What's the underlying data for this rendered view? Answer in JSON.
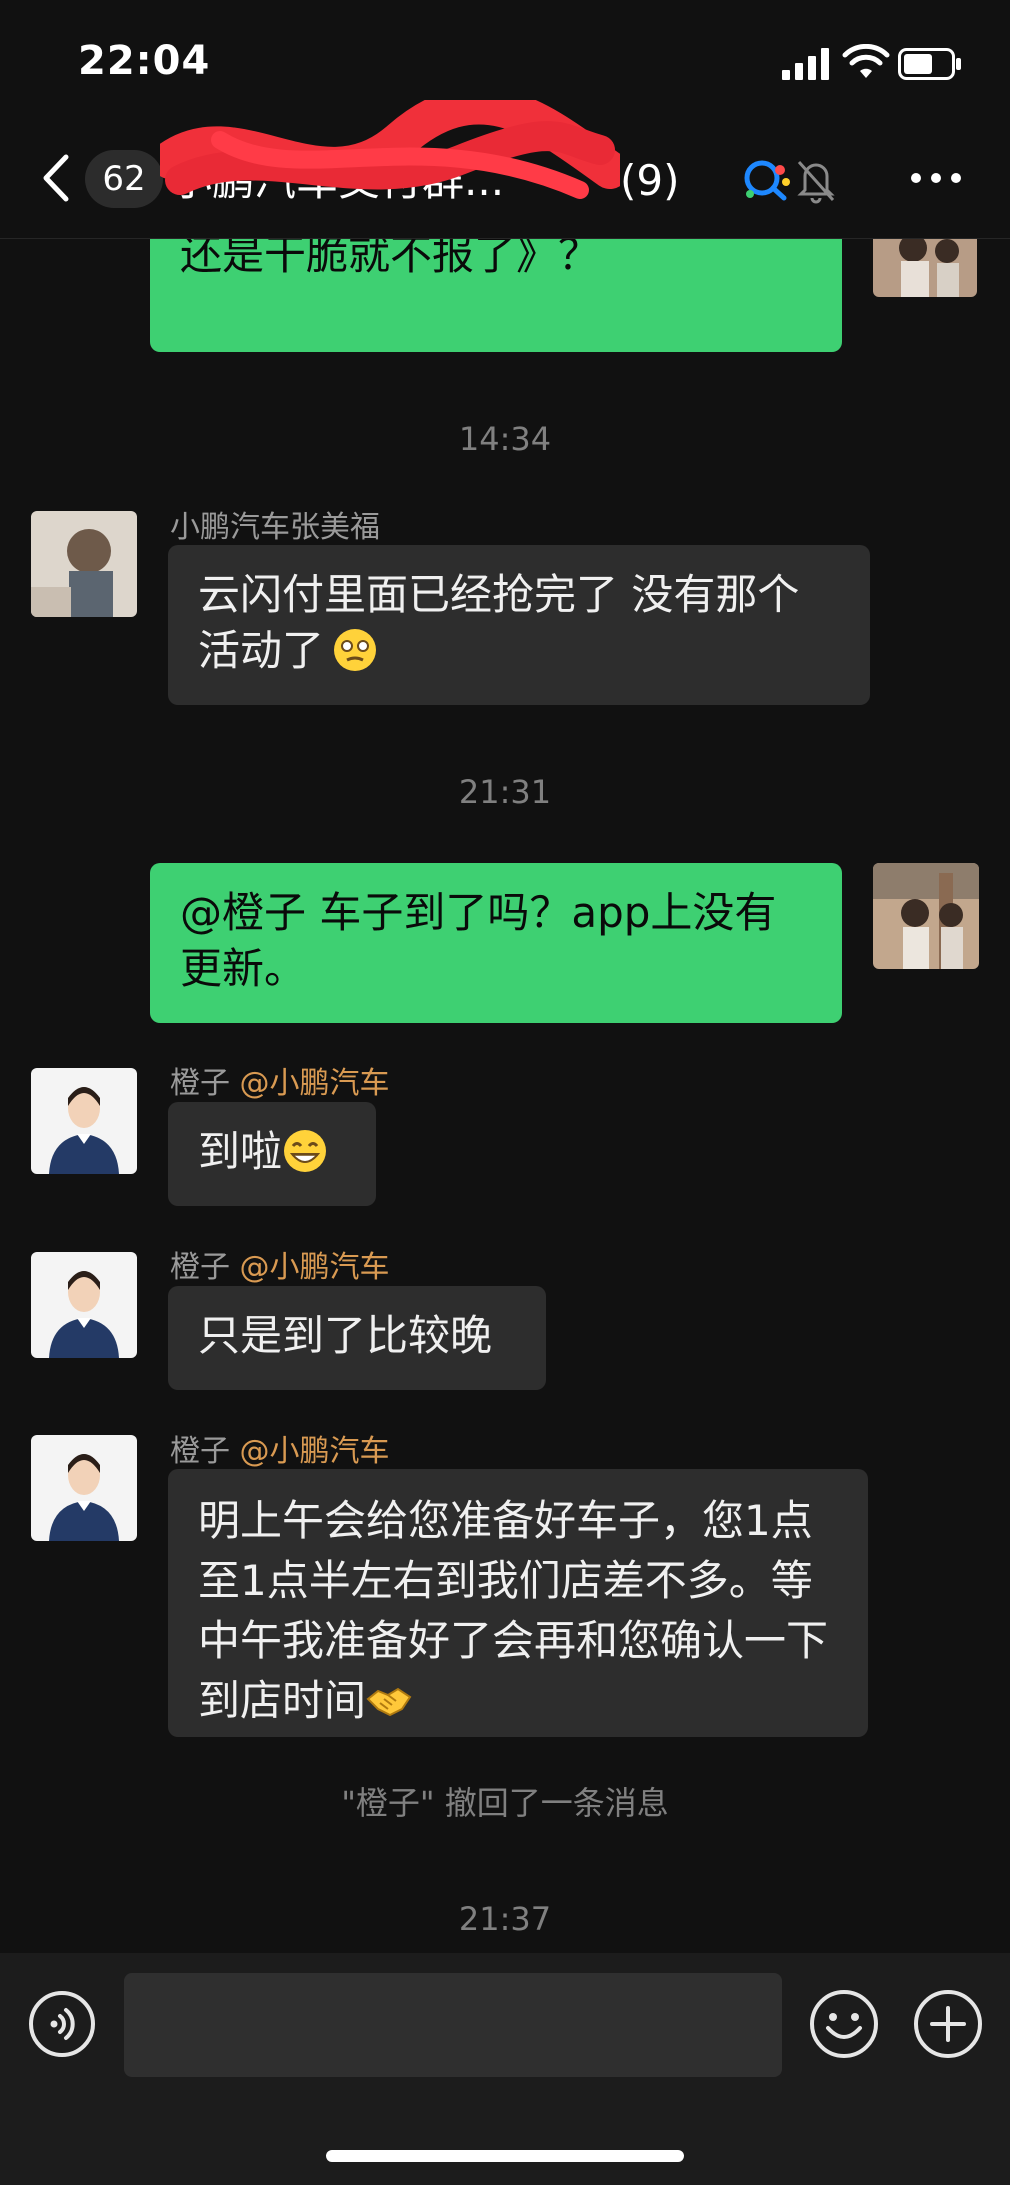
{
  "status_bar": {
    "time": "22:04"
  },
  "header": {
    "badge_count": "62",
    "title": "小鹏汽车交付群...",
    "member_count": "(9)"
  },
  "messages": {
    "m1_text": "那你们这边还是试着上报一下补贴还是干脆就不报了》？",
    "t1": "14:34",
    "m2_sender": "小鹏汽车张美福",
    "m2_text": "云闪付里面已经抢完了 没有那个活动了",
    "t2": "21:31",
    "m3_text": "@橙子 车子到了吗？app上没有更新。",
    "m4_sender": "橙子",
    "m4_tag": "@小鹏汽车",
    "m4_text": "到啦",
    "m5_sender": "橙子",
    "m5_tag": "@小鹏汽车",
    "m5_text": "只是到了比较晚",
    "m6_sender": "橙子",
    "m6_tag": "@小鹏汽车",
    "m6_text": "明上午会给您准备好车子，您1点至1点半左右到我们店差不多。等中午我准备好了会再和您确认一下到店时间",
    "recall_notice": "\"橙子\" 撤回了一条消息",
    "t3": "21:37"
  },
  "input": {
    "value": "",
    "placeholder": ""
  },
  "icons": {
    "back": "chevron-left-icon",
    "qq": "qq-icon",
    "mute": "bell-off-icon",
    "more": "more-icon",
    "voice": "voice-icon",
    "emoji": "smile-icon",
    "plus": "plus-icon"
  },
  "colors": {
    "background": "#111111",
    "bubble_self": "#3ed072",
    "bubble_other": "#2d2d2d",
    "mention": "#d99a52",
    "accent_blue": "#1e88ff"
  }
}
